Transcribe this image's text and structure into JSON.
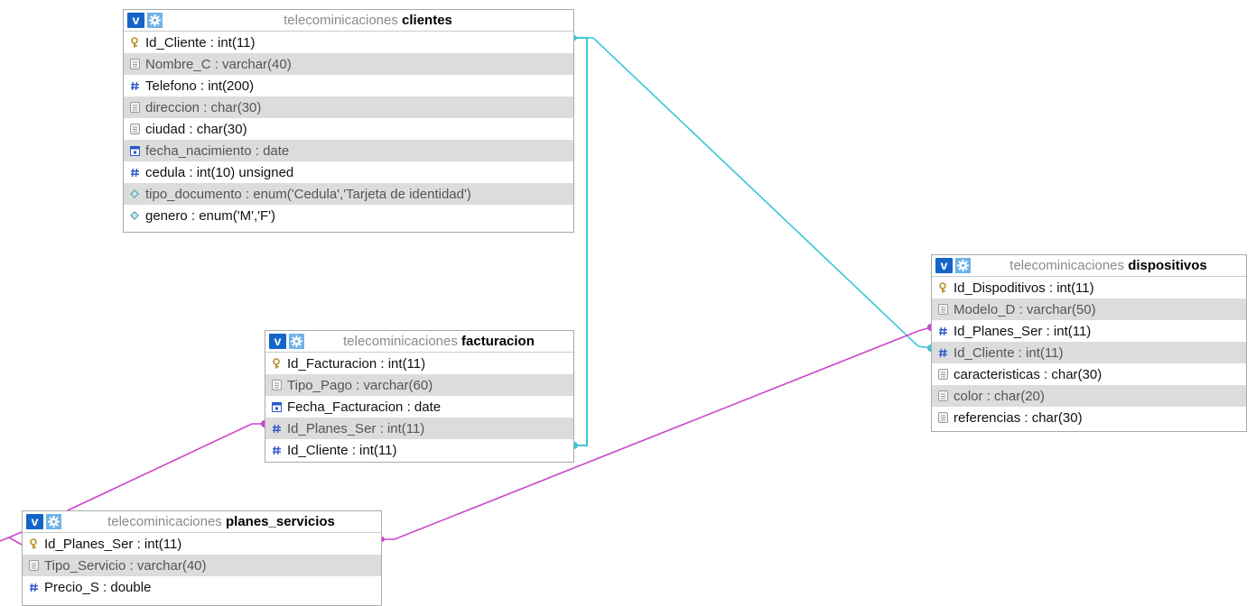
{
  "database": "telecominicaciones",
  "colors": {
    "cyan_relation": "#3cc6d4",
    "magenta_relation": "#cc44cc",
    "header_icon_blue": "#1565c8",
    "alt_row_bg": "#dcdcdc"
  },
  "tables": [
    {
      "name": "clientes",
      "columns": [
        {
          "text": "Id_Cliente : int(11)",
          "icon": "primary-key-icon"
        },
        {
          "text": "Nombre_C : varchar(40)",
          "icon": "text-column-icon"
        },
        {
          "text": "Telefono : int(200)",
          "icon": "number-column-icon"
        },
        {
          "text": "direccion : char(30)",
          "icon": "text-column-icon"
        },
        {
          "text": "ciudad : char(30)",
          "icon": "text-column-icon"
        },
        {
          "text": "fecha_nacimiento : date",
          "icon": "date-column-icon"
        },
        {
          "text": "cedula : int(10) unsigned",
          "icon": "number-column-icon"
        },
        {
          "text": "tipo_documento : enum('Cedula','Tarjeta de identidad')",
          "icon": "enum-column-icon"
        },
        {
          "text": "genero : enum('M','F')",
          "icon": "enum-column-icon"
        }
      ]
    },
    {
      "name": "facturacion",
      "columns": [
        {
          "text": "Id_Facturacion : int(11)",
          "icon": "primary-key-icon"
        },
        {
          "text": "Tipo_Pago : varchar(60)",
          "icon": "text-column-icon"
        },
        {
          "text": "Fecha_Facturacion : date",
          "icon": "date-column-icon"
        },
        {
          "text": "Id_Planes_Ser : int(11)",
          "icon": "number-column-icon"
        },
        {
          "text": "Id_Cliente : int(11)",
          "icon": "number-column-icon"
        }
      ]
    },
    {
      "name": "dispositivos",
      "columns": [
        {
          "text": "Id_Dispoditivos : int(11)",
          "icon": "primary-key-icon"
        },
        {
          "text": "Modelo_D : varchar(50)",
          "icon": "text-column-icon"
        },
        {
          "text": "Id_Planes_Ser : int(11)",
          "icon": "number-column-icon"
        },
        {
          "text": "Id_Cliente : int(11)",
          "icon": "number-column-icon"
        },
        {
          "text": "caracteristicas : char(30)",
          "icon": "text-column-icon"
        },
        {
          "text": "color : char(20)",
          "icon": "text-column-icon"
        },
        {
          "text": "referencias : char(30)",
          "icon": "text-column-icon"
        }
      ]
    },
    {
      "name": "planes_servicios",
      "columns": [
        {
          "text": "Id_Planes_Ser : int(11)",
          "icon": "primary-key-icon"
        },
        {
          "text": "Tipo_Servicio : varchar(40)",
          "icon": "text-column-icon"
        },
        {
          "text": "Precio_S : double",
          "icon": "number-column-icon"
        }
      ]
    }
  ]
}
